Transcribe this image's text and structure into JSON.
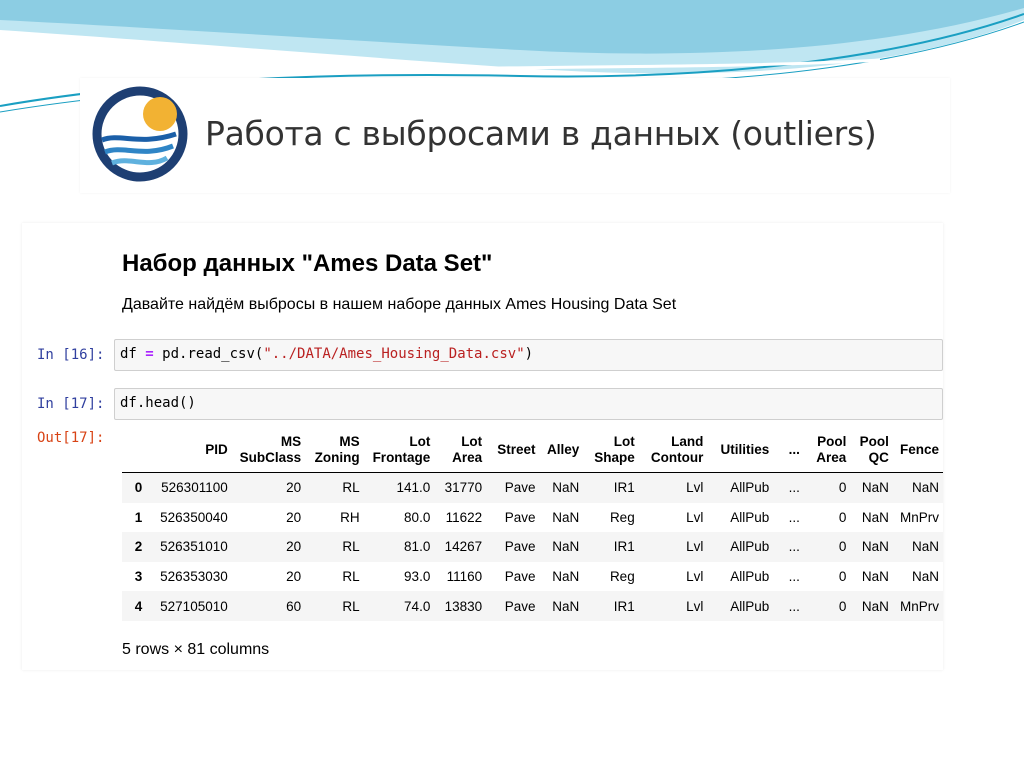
{
  "slide": {
    "title": "Работа с выбросами в данных (outliers)",
    "colors": {
      "wave_dark": "#1a9fc2",
      "wave_light": "#bfe6f2",
      "logo_ring": "#1e3f73",
      "logo_sun": "#f2b233"
    },
    "logo_icon": "sun-over-sea-logo"
  },
  "notebook": {
    "heading": "Набор данных \"Ames Data Set\"",
    "description": "Давайте найдём выбросы в нашем наборе данных Ames Housing Data Set",
    "cell1": {
      "prompt": "In [16]:",
      "code": {
        "var": "df",
        "op": "=",
        "call": "pd.read_csv(",
        "str": "\"../DATA/Ames_Housing_Data.csv\"",
        "close": ")"
      }
    },
    "cell2": {
      "prompt": "In [17]:",
      "code": "df.head()"
    },
    "output": {
      "prompt": "Out[17]:",
      "columns": [
        {
          "l1": "",
          "l2": ""
        },
        {
          "l1": "",
          "l2": "PID"
        },
        {
          "l1": "MS",
          "l2": "SubClass"
        },
        {
          "l1": "MS",
          "l2": "Zoning"
        },
        {
          "l1": "Lot",
          "l2": "Frontage"
        },
        {
          "l1": "Lot",
          "l2": "Area"
        },
        {
          "l1": "",
          "l2": "Street"
        },
        {
          "l1": "",
          "l2": "Alley"
        },
        {
          "l1": "Lot",
          "l2": "Shape"
        },
        {
          "l1": "Land",
          "l2": "Contour"
        },
        {
          "l1": "",
          "l2": "Utilities"
        },
        {
          "l1": "",
          "l2": "..."
        },
        {
          "l1": "Pool",
          "l2": "Area"
        },
        {
          "l1": "Pool",
          "l2": "QC"
        },
        {
          "l1": "",
          "l2": "Fence"
        }
      ],
      "rows": [
        [
          "0",
          "526301100",
          "20",
          "RL",
          "141.0",
          "31770",
          "Pave",
          "NaN",
          "IR1",
          "Lvl",
          "AllPub",
          "...",
          "0",
          "NaN",
          "NaN"
        ],
        [
          "1",
          "526350040",
          "20",
          "RH",
          "80.0",
          "11622",
          "Pave",
          "NaN",
          "Reg",
          "Lvl",
          "AllPub",
          "...",
          "0",
          "NaN",
          "MnPrv"
        ],
        [
          "2",
          "526351010",
          "20",
          "RL",
          "81.0",
          "14267",
          "Pave",
          "NaN",
          "IR1",
          "Lvl",
          "AllPub",
          "...",
          "0",
          "NaN",
          "NaN"
        ],
        [
          "3",
          "526353030",
          "20",
          "RL",
          "93.0",
          "11160",
          "Pave",
          "NaN",
          "Reg",
          "Lvl",
          "AllPub",
          "...",
          "0",
          "NaN",
          "NaN"
        ],
        [
          "4",
          "527105010",
          "60",
          "RL",
          "74.0",
          "13830",
          "Pave",
          "NaN",
          "IR1",
          "Lvl",
          "AllPub",
          "...",
          "0",
          "NaN",
          "MnPrv"
        ]
      ],
      "footer": "5 rows × 81 columns"
    }
  }
}
